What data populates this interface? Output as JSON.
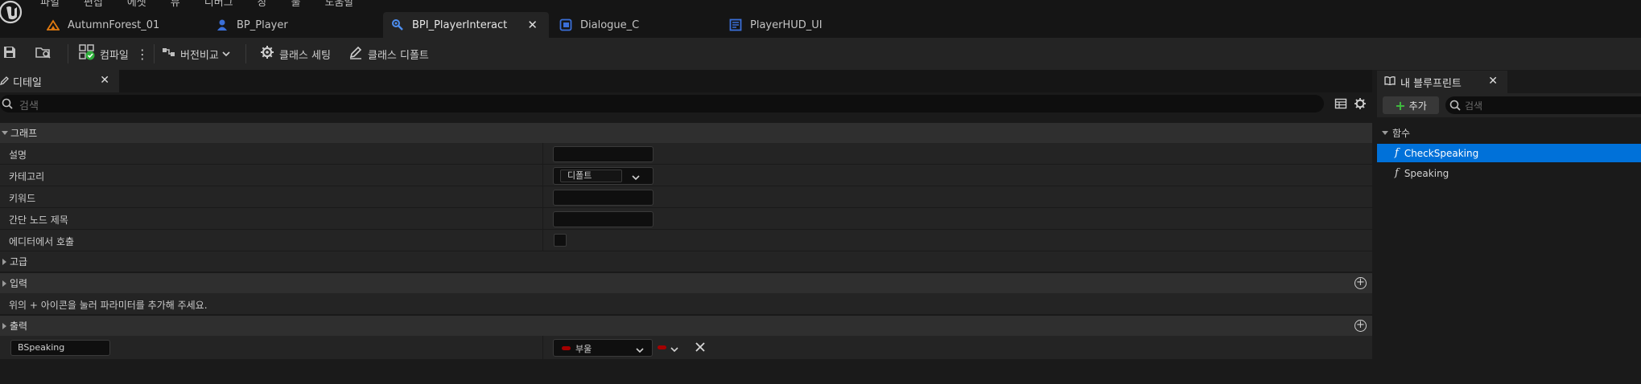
{
  "menu": [
    "파일",
    "편집",
    "에셋",
    "뷰",
    "디버그",
    "창",
    "툴",
    "도움말"
  ],
  "tabs": [
    {
      "label": "AutumnForest_01",
      "icon": "level-icon",
      "active": false
    },
    {
      "label": "BP_Player",
      "icon": "actor-blueprint-icon",
      "active": false
    },
    {
      "label": "BPI_PlayerInteract",
      "icon": "interface-blueprint-icon",
      "active": true,
      "close": "✕"
    },
    {
      "label": "Dialogue_C",
      "icon": "widget-blueprint-icon",
      "active": false
    },
    {
      "label": "PlayerHUD_UI",
      "icon": "widget-blueprint-icon",
      "active": false
    }
  ],
  "toolbar": {
    "compile": "컴파일",
    "diff": "버전비교",
    "class_settings": "클래스 세팅",
    "class_defaults": "클래스 디폴트"
  },
  "details": {
    "tab_label": "디테일",
    "search_placeholder": "검색",
    "graph_section": "그래프",
    "rows": {
      "description": "설명",
      "category": "카테고리",
      "category_value": "디폴트",
      "keywords": "키워드",
      "compact_title": "간단 노드 제목",
      "call_in_editor": "에디터에서 호출"
    },
    "advanced_section": "고급",
    "inputs_section": "입력",
    "inputs_hint": "위의 + 아이콘을 눌러 파라미터를 추가해 주세요.",
    "outputs_section": "출력",
    "output_param": {
      "name": "BSpeaking",
      "type": "부울",
      "type_color": "#a50000"
    }
  },
  "my_blueprint": {
    "tab_label": "내 블루프린트",
    "add_label": "추가",
    "search_placeholder": "검색",
    "category": "함수",
    "functions": [
      {
        "name": "CheckSpeaking",
        "selected": true
      },
      {
        "name": "Speaking",
        "selected": false
      }
    ]
  },
  "colors": {
    "selection": "#0071d9",
    "add_plus": "#3fbf3f",
    "bool_pin": "#a50000"
  }
}
